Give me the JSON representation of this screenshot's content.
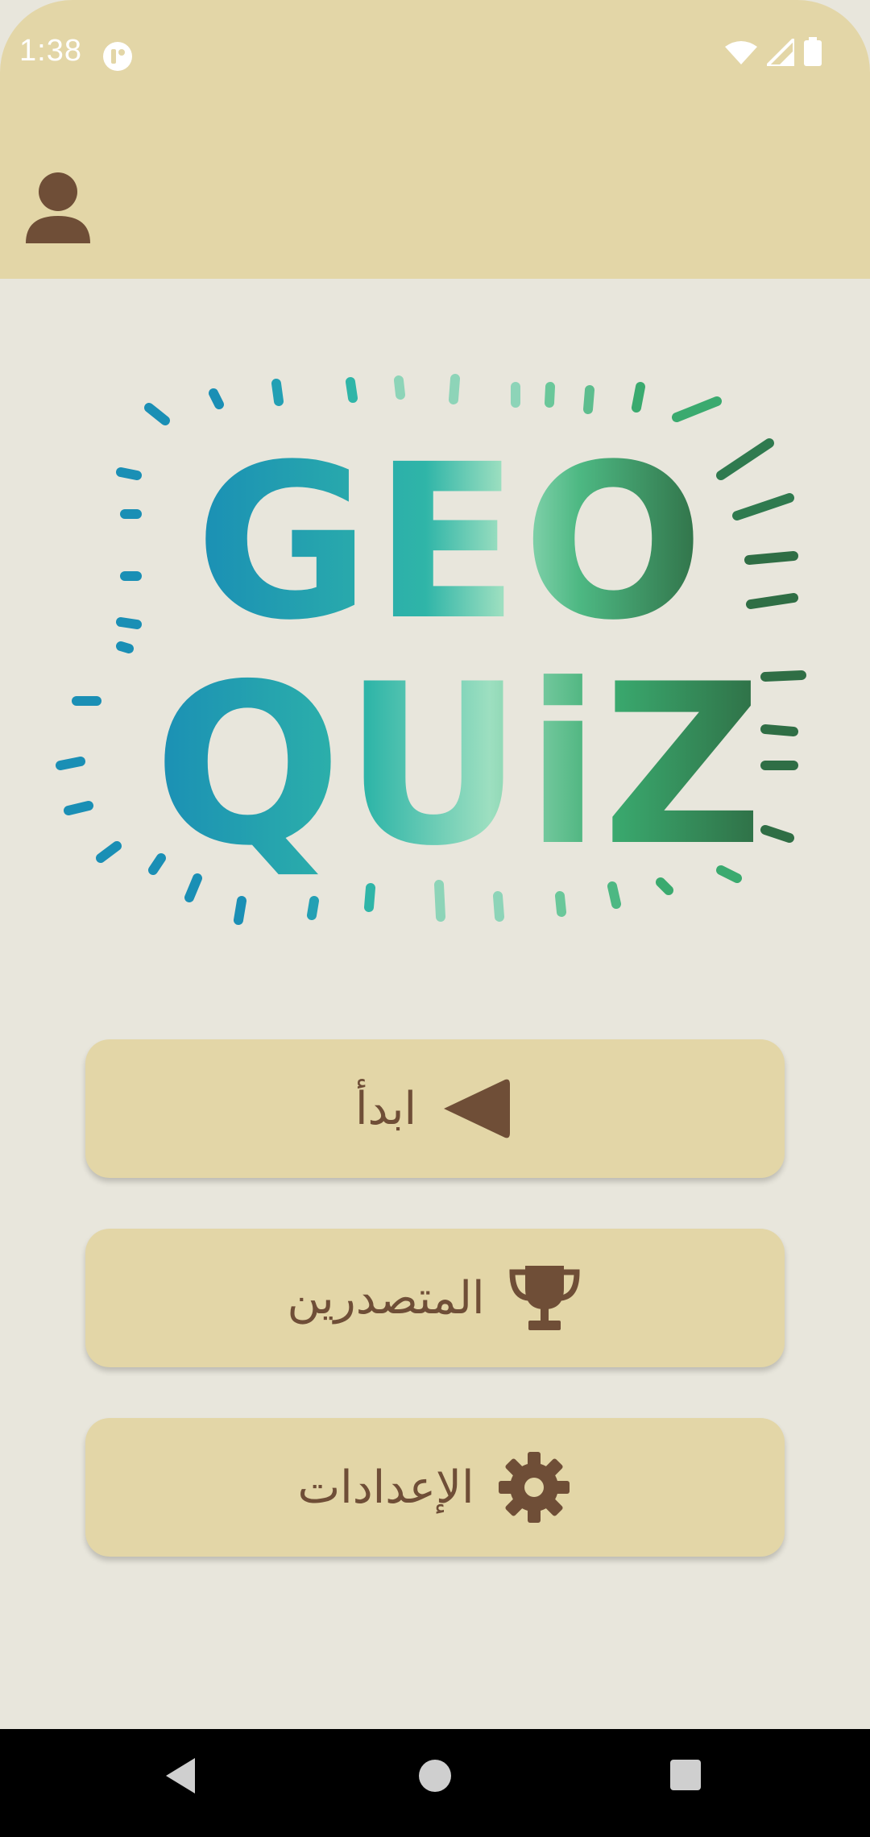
{
  "status_bar": {
    "time": "1:38",
    "icons": [
      "app-notification-icon",
      "wifi-icon",
      "signal-icon",
      "battery-icon"
    ]
  },
  "app_bar": {
    "profile_icon": "person-icon"
  },
  "logo": {
    "line1": "GEO",
    "line2": "QUiZ"
  },
  "menu": {
    "start": {
      "label": "ابدأ",
      "icon": "play-icon"
    },
    "leaderboard": {
      "label": "المتصدرين",
      "icon": "trophy-icon"
    },
    "settings": {
      "label": "الإعدادات",
      "icon": "gear-icon"
    }
  },
  "nav_bar": {
    "icons": [
      "back-icon",
      "home-icon",
      "recents-icon"
    ]
  },
  "colors": {
    "app_bar": "#e3d6a7",
    "background": "#e8e6dc",
    "button": "#e3d6a7",
    "accent_brown": "#6f4e37",
    "logo_teal": "#1a8fb5",
    "logo_green": "#2f6e45"
  }
}
